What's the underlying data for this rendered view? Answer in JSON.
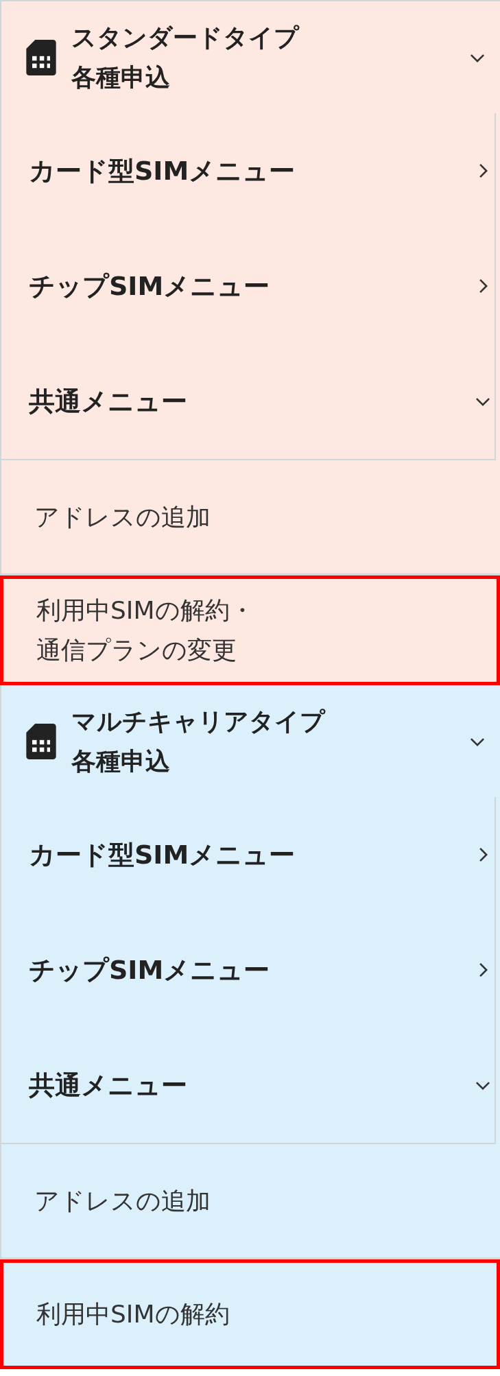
{
  "sections": [
    {
      "title_lines": [
        "スタンダードタイプ",
        "各種申込"
      ],
      "color": "#fee8e2",
      "expanded": true,
      "submenus": [
        {
          "label": "カード型SIMメニュー",
          "expanded": false
        },
        {
          "label": "チップSIMメニュー",
          "expanded": false
        },
        {
          "label": "共通メニュー",
          "expanded": true
        }
      ],
      "links": [
        {
          "lines": [
            "アドレスの追加"
          ],
          "highlighted": false
        },
        {
          "lines": [
            "利用中SIMの解約・",
            "通信プランの変更"
          ],
          "highlighted": true
        }
      ]
    },
    {
      "title_lines": [
        "マルチキャリアタイプ",
        "各種申込"
      ],
      "color": "#dcf0fc",
      "expanded": true,
      "submenus": [
        {
          "label": "カード型SIMメニュー",
          "expanded": false
        },
        {
          "label": "チップSIMメニュー",
          "expanded": false
        },
        {
          "label": "共通メニュー",
          "expanded": true
        }
      ],
      "links": [
        {
          "lines": [
            "アドレスの追加"
          ],
          "highlighted": false
        },
        {
          "lines": [
            "利用中SIMの解約"
          ],
          "highlighted": true
        }
      ]
    }
  ]
}
